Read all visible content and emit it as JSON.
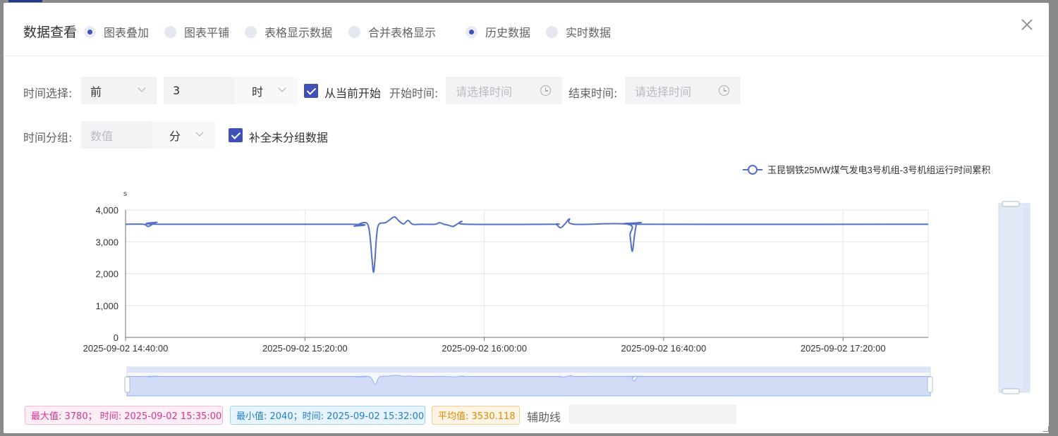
{
  "dialog": {
    "title": "数据查看",
    "view_modes": [
      {
        "label": "图表叠加",
        "checked": true
      },
      {
        "label": "图表平铺",
        "checked": false
      },
      {
        "label": "表格显示数据",
        "checked": false
      },
      {
        "label": "合并表格显示",
        "checked": false
      }
    ],
    "data_modes": [
      {
        "label": "历史数据",
        "checked": true
      },
      {
        "label": "实时数据",
        "checked": false
      }
    ]
  },
  "filters": {
    "time_select_label": "时间选择:",
    "relative_value": "前",
    "amount_value": "3",
    "unit_value": "时",
    "from_now_label": "从当前开始",
    "start_label": "开始时间:",
    "start_placeholder": "请选择时间",
    "end_label": "结束时间:",
    "end_placeholder": "请选择时间",
    "group_label": "时间分组:",
    "group_placeholder": "数值",
    "group_unit": "分",
    "fill_label": "补全未分组数据"
  },
  "chart_data": {
    "type": "line",
    "unit": "s",
    "series_name": "玉昆钢铁25MW煤气发电3号机组-3号机组运行时间累积",
    "color": "#5470c6",
    "ylim": [
      0,
      4000
    ],
    "yticks": [
      "4,000",
      "3,000",
      "2,000",
      "1,000",
      "0"
    ],
    "xticks": [
      "2025-09-02 14:40:00",
      "2025-09-02 15:20:00",
      "2025-09-02 16:00:00",
      "2025-09-02 16:40:00",
      "2025-09-02 17:20:00"
    ],
    "x_minutes_from_start_range": [
      0,
      179
    ],
    "points": [
      [
        0,
        3550
      ],
      [
        4,
        3550
      ],
      [
        5,
        3480
      ],
      [
        6,
        3550
      ],
      [
        7,
        3610
      ],
      [
        8,
        3550
      ],
      [
        50,
        3550
      ],
      [
        51,
        3490
      ],
      [
        52,
        3550
      ],
      [
        53,
        3600
      ],
      [
        54,
        3550
      ],
      [
        54.5,
        3200
      ],
      [
        55,
        2400
      ],
      [
        55.3,
        2040
      ],
      [
        55.6,
        2400
      ],
      [
        56,
        3200
      ],
      [
        56.5,
        3550
      ],
      [
        58,
        3600
      ],
      [
        59,
        3700
      ],
      [
        60,
        3780
      ],
      [
        61,
        3650
      ],
      [
        62,
        3560
      ],
      [
        63,
        3670
      ],
      [
        64,
        3550
      ],
      [
        66,
        3550
      ],
      [
        69,
        3550
      ],
      [
        70,
        3600
      ],
      [
        71,
        3550
      ],
      [
        72,
        3520
      ],
      [
        73,
        3480
      ],
      [
        74,
        3560
      ],
      [
        75,
        3640
      ],
      [
        76,
        3550
      ],
      [
        95,
        3550
      ],
      [
        96,
        3550
      ],
      [
        97,
        3440
      ],
      [
        98,
        3560
      ],
      [
        99,
        3720
      ],
      [
        100,
        3550
      ],
      [
        112,
        3550
      ],
      [
        112.5,
        3200
      ],
      [
        113,
        2700
      ],
      [
        113.5,
        3200
      ],
      [
        114,
        3560
      ],
      [
        115,
        3600
      ],
      [
        116,
        3550
      ],
      [
        179,
        3550
      ]
    ]
  },
  "stats": {
    "max": "最大值: 3780；  时间: 2025-09-02 15:35:00",
    "min": "最小值: 2040；时间: 2025-09-02 15:32:00",
    "avg": "平均值: 3530.118"
  },
  "aux_label": "辅助线"
}
